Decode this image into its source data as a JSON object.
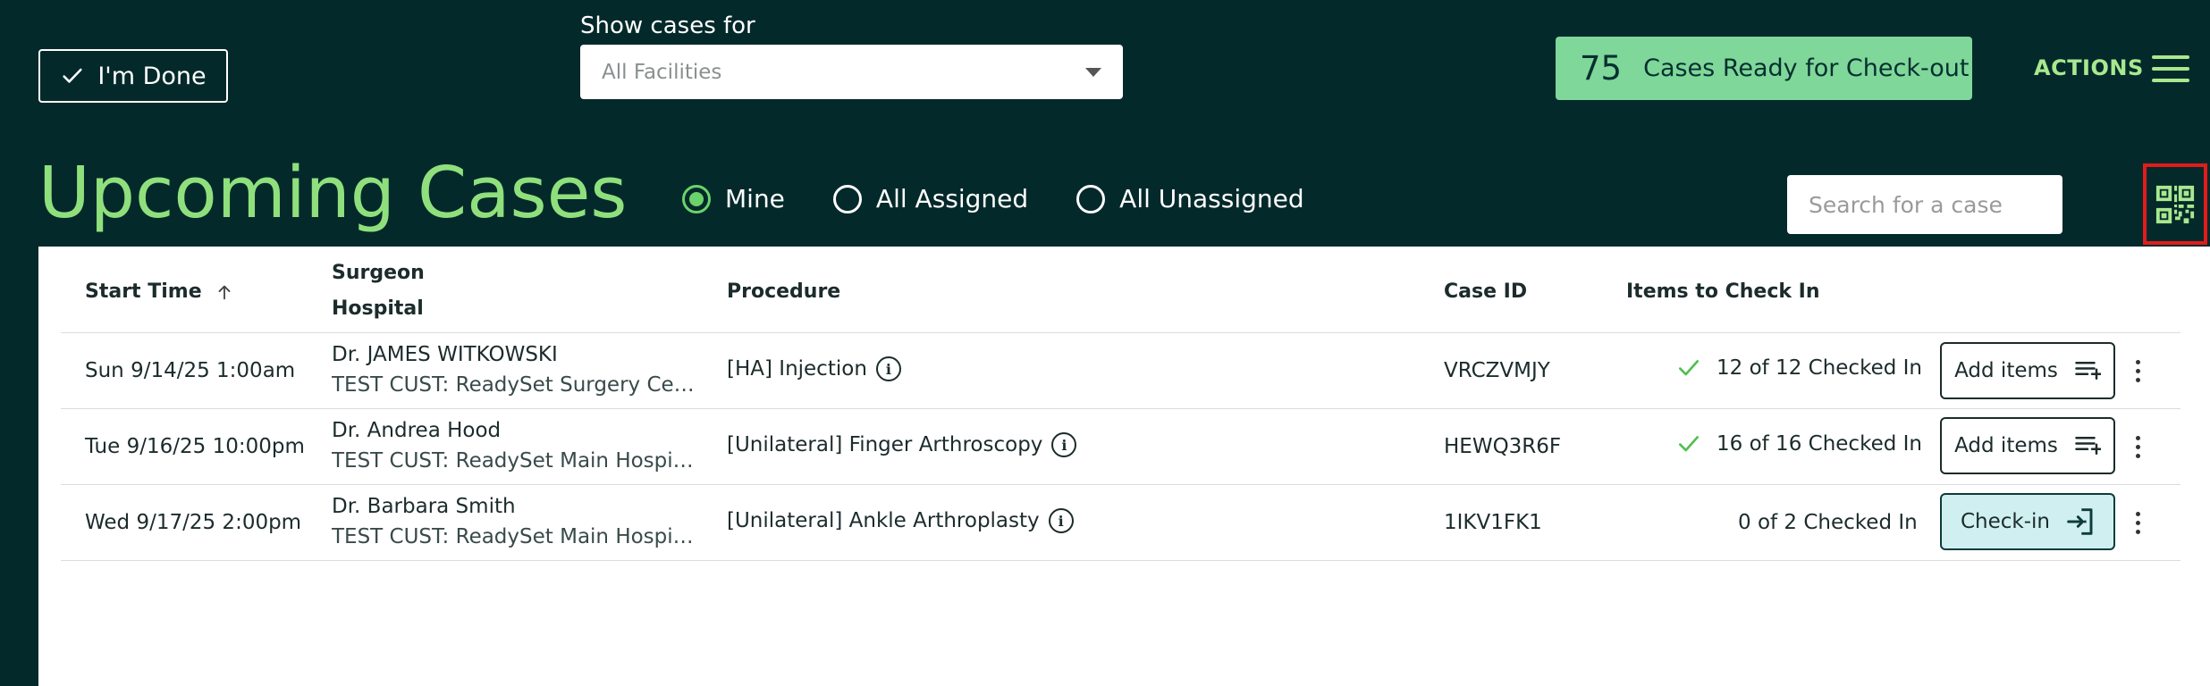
{
  "header": {
    "done_label": "I'm Done",
    "show_cases_label": "Show cases for",
    "facility_select": "All Facilities",
    "ready_count": "75",
    "ready_text": "Cases Ready for Check-out",
    "actions_label": "ACTIONS"
  },
  "title": "Upcoming Cases",
  "filters": [
    {
      "label": "Mine",
      "selected": true
    },
    {
      "label": "All Assigned",
      "selected": false
    },
    {
      "label": "All Unassigned",
      "selected": false
    }
  ],
  "search": {
    "placeholder": "Search for a case"
  },
  "table": {
    "columns": {
      "start_time": "Start Time",
      "surgeon": "Surgeon",
      "hospital": "Hospital",
      "procedure": "Procedure",
      "case_id": "Case ID",
      "items": "Items to Check In"
    },
    "rows": [
      {
        "start": "Sun 9/14/25 1:00am",
        "surgeon": "Dr. JAMES WITKOWSKI",
        "hospital": "TEST CUST: ReadySet Surgery Center",
        "procedure": "[HA] Injection",
        "case_id": "VRCZVMJY",
        "items": "12 of 12 Checked In",
        "complete": true,
        "action": "Add items"
      },
      {
        "start": "Tue 9/16/25 10:00pm",
        "surgeon": "Dr. Andrea Hood",
        "hospital": "TEST CUST: ReadySet Main Hospital",
        "procedure": "[Unilateral] Finger Arthroscopy",
        "case_id": "HEWQ3R6F",
        "items": "16 of 16 Checked In",
        "complete": true,
        "action": "Add items"
      },
      {
        "start": "Wed 9/17/25 2:00pm",
        "surgeon": "Dr. Barbara Smith",
        "hospital": "TEST CUST: ReadySet Main Hospital",
        "procedure": "[Unilateral] Ankle Arthroplasty",
        "case_id": "1IKV1FK1",
        "items": "0 of 2 Checked In",
        "complete": false,
        "action": "Check-in"
      }
    ]
  },
  "colors": {
    "background": "#04292a",
    "title_green": "#8fe07d",
    "ready_green": "#7fd79a",
    "checkin_bg": "#cfeff0",
    "highlight_red": "#e01c1c"
  }
}
